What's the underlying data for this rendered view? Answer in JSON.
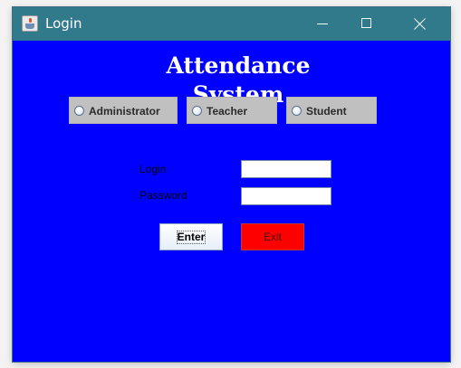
{
  "window": {
    "title": "Login",
    "app_icon": "java-cup-icon",
    "controls": {
      "minimize": "minimize-icon",
      "maximize": "maximize-icon",
      "close": "close-icon"
    }
  },
  "content": {
    "heading": "Attendance System",
    "roles": [
      {
        "label": "Administrator",
        "selected": false
      },
      {
        "label": "Teacher",
        "selected": false
      },
      {
        "label": "Student",
        "selected": false
      }
    ],
    "fields": {
      "login_label": "Login",
      "login_value": "",
      "password_label": "Password",
      "password_value": ""
    },
    "buttons": {
      "enter_label": "Enter",
      "exit_label": "Exit"
    }
  },
  "colors": {
    "titlebar": "#307a8c",
    "background": "#0000ff",
    "role_box": "#c0c0c0",
    "exit_button": "#ff0000",
    "heading_text": "#ffffff"
  }
}
